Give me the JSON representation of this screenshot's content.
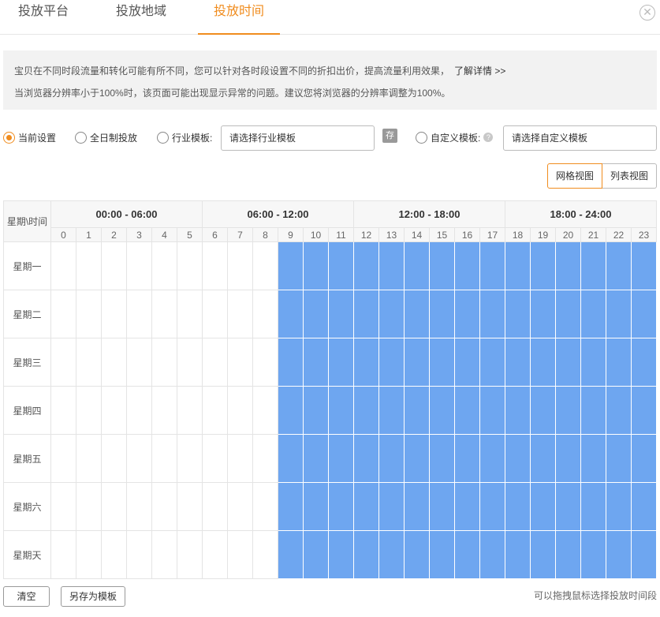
{
  "tabs": [
    {
      "label": "投放平台",
      "active": false
    },
    {
      "label": "投放地域",
      "active": false
    },
    {
      "label": "投放时间",
      "active": true
    }
  ],
  "close_icon": "close-circle-icon",
  "notice": {
    "line1": "宝贝在不同时段流量和转化可能有所不同，您可以针对各时段设置不同的折扣出价，提高流量利用效果，",
    "link": "了解详情 >>",
    "line2": "当浏览器分辨率小于100%时，该页面可能出现显示异常的问题。建议您将浏览器的分辨率调整为100%。"
  },
  "options": {
    "current": "当前设置",
    "all_day": "全日制投放",
    "industry": "行业模板:",
    "industry_placeholder": "请选择行业模板",
    "save_icon_label": "存",
    "custom": "自定义模板:",
    "custom_placeholder": "请选择自定义模板",
    "selected": "current"
  },
  "views": {
    "grid": "网格视图",
    "list": "列表视图",
    "active": "grid"
  },
  "schedule": {
    "corner": "星期\\时间",
    "ranges": [
      "00:00 - 06:00",
      "06:00 - 12:00",
      "12:00 - 18:00",
      "18:00 - 24:00"
    ],
    "hours": [
      "0",
      "1",
      "2",
      "3",
      "4",
      "5",
      "6",
      "7",
      "8",
      "9",
      "10",
      "11",
      "12",
      "13",
      "14",
      "15",
      "16",
      "17",
      "18",
      "19",
      "20",
      "21",
      "22",
      "23"
    ],
    "days": [
      "星期一",
      "星期二",
      "星期三",
      "星期四",
      "星期五",
      "星期六",
      "星期天"
    ],
    "active_from_hour": 9,
    "active_to_hour": 23,
    "active_color": "#6ea6f0"
  },
  "footer": {
    "clear": "清空",
    "save_as_template": "另存为模板",
    "hint": "可以拖拽鼠标选择投放时间段"
  },
  "accent_color": "#f08c1e"
}
